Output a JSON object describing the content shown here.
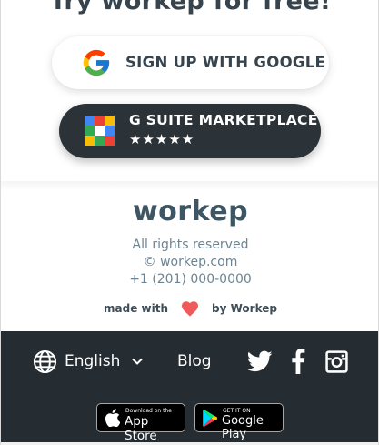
{
  "headline": "Try workep for free!",
  "google_button": {
    "label": "SIGN UP WITH GOOGLE",
    "icon": "google-g-icon"
  },
  "gsuite_button": {
    "label": "G SUITE MARKETPLACE",
    "stars": "★★★★★",
    "rating": 5,
    "icon": "marketplace-icon"
  },
  "footer": {
    "brand": "workep",
    "rights": "All rights reserved",
    "website": "© workep.com",
    "phone": "+1 (201) 000-0000",
    "made_with_prefix": "made with",
    "made_with_suffix": "by Workep",
    "heart_color": "#ef5b5b"
  },
  "bottom_bar": {
    "language": "English",
    "blog": "Blog",
    "social_icons": [
      "twitter-icon",
      "facebook-icon",
      "instagram-icon"
    ],
    "app_store": {
      "small": "Download on the",
      "big": "App Store"
    },
    "google_play": {
      "small": "GET IT ON",
      "big": "Google Play"
    }
  },
  "colors": {
    "dark_bar": "#262d32",
    "text_dark": "#37434d",
    "muted": "#6b8594"
  }
}
